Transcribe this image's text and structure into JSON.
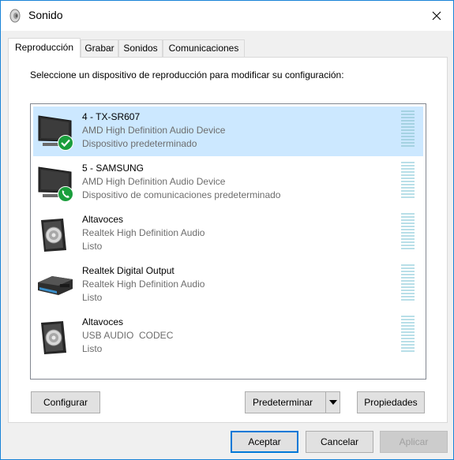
{
  "window": {
    "title": "Sonido"
  },
  "tabs": [
    {
      "label": "Reproducción",
      "active": true
    },
    {
      "label": "Grabar",
      "active": false
    },
    {
      "label": "Sonidos",
      "active": false
    },
    {
      "label": "Comunicaciones",
      "active": false
    }
  ],
  "instruction": "Seleccione un dispositivo de reproducción para modificar su configuración:",
  "devices": [
    {
      "name": "4 - TX-SR607",
      "driver": "AMD High Definition Audio Device",
      "status": "Dispositivo predeterminado",
      "icon": "monitor-icon",
      "badge": "default-check-icon",
      "selected": true
    },
    {
      "name": "5 - SAMSUNG",
      "driver": "AMD High Definition Audio Device",
      "status": "Dispositivo de comunicaciones predeterminado",
      "icon": "monitor-icon",
      "badge": "phone-badge-icon",
      "selected": false
    },
    {
      "name": "Altavoces",
      "driver": "Realtek High Definition Audio",
      "status": "Listo",
      "icon": "speaker-icon",
      "selected": false
    },
    {
      "name": "Realtek Digital Output",
      "driver": "Realtek High Definition Audio",
      "status": "Listo",
      "icon": "receiver-icon",
      "selected": false
    },
    {
      "name": "Altavoces",
      "driver": "USB AUDIO  CODEC",
      "status": "Listo",
      "icon": "speaker-icon",
      "selected": false
    }
  ],
  "buttons": {
    "configure": "Configurar",
    "set_default": "Predeterminar",
    "properties": "Propiedades",
    "accept": "Aceptar",
    "cancel": "Cancelar",
    "apply": "Aplicar"
  },
  "colors": {
    "selection": "#cce8ff",
    "accent": "#0078d7",
    "badge_green": "#1a9e3c"
  }
}
